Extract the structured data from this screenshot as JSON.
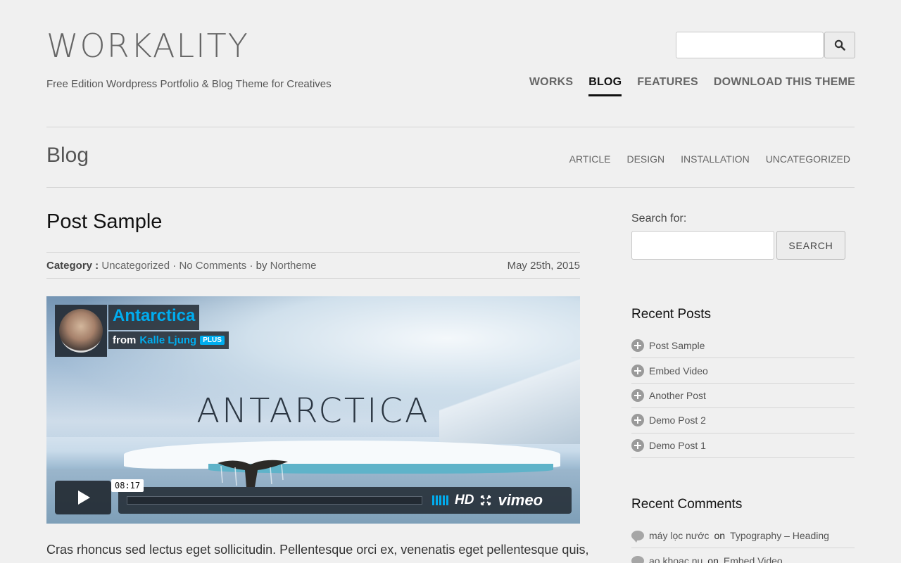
{
  "header": {
    "logo": "WORKALITY",
    "tagline": "Free Edition Wordpress Portfolio & Blog Theme for Creatives",
    "search_value": "",
    "nav": [
      {
        "label": "WORKS",
        "active": false
      },
      {
        "label": "BLOG",
        "active": true
      },
      {
        "label": "FEATURES",
        "active": false
      },
      {
        "label": "DOWNLOAD THIS THEME",
        "active": false
      }
    ]
  },
  "blog_bar": {
    "title": "Blog",
    "categories": [
      "ARTICLE",
      "DESIGN",
      "INSTALLATION",
      "UNCATEGORIZED"
    ]
  },
  "post": {
    "title": "Post Sample",
    "category_label": "Category :",
    "category": "Uncategorized",
    "sep1": "·",
    "comments": "No Comments",
    "sep2": "· by",
    "author": "Northeme",
    "date": "May 25th, 2015",
    "video": {
      "title": "Antarctica",
      "from_label": "from",
      "from_name": "Kalle Ljung",
      "badge": "PLUS",
      "overlay_word": "ANTARCTICA",
      "time": "08:17",
      "hd": "HD",
      "brand": "vimeo"
    },
    "excerpt": "Cras rhoncus sed lectus eget sollicitudin. Pellentesque orci ex, venenatis eget pellentesque quis,"
  },
  "sidebar": {
    "search_label": "Search for:",
    "search_button": "SEARCH",
    "recent_posts_title": "Recent Posts",
    "recent_posts": [
      "Post Sample",
      "Embed Video",
      "Another Post",
      "Demo Post 2",
      "Demo Post 1"
    ],
    "recent_comments_title": "Recent Comments",
    "recent_comments": [
      {
        "author": "máy lọc nước",
        "on": "on",
        "post": "Typography – Heading"
      },
      {
        "author": "ao khoac nu",
        "on": "on",
        "post": "Embed Video"
      }
    ]
  },
  "colors": {
    "background": "#f0f0f0",
    "vimeo_blue": "#00adef",
    "active_nav": "#111111"
  }
}
